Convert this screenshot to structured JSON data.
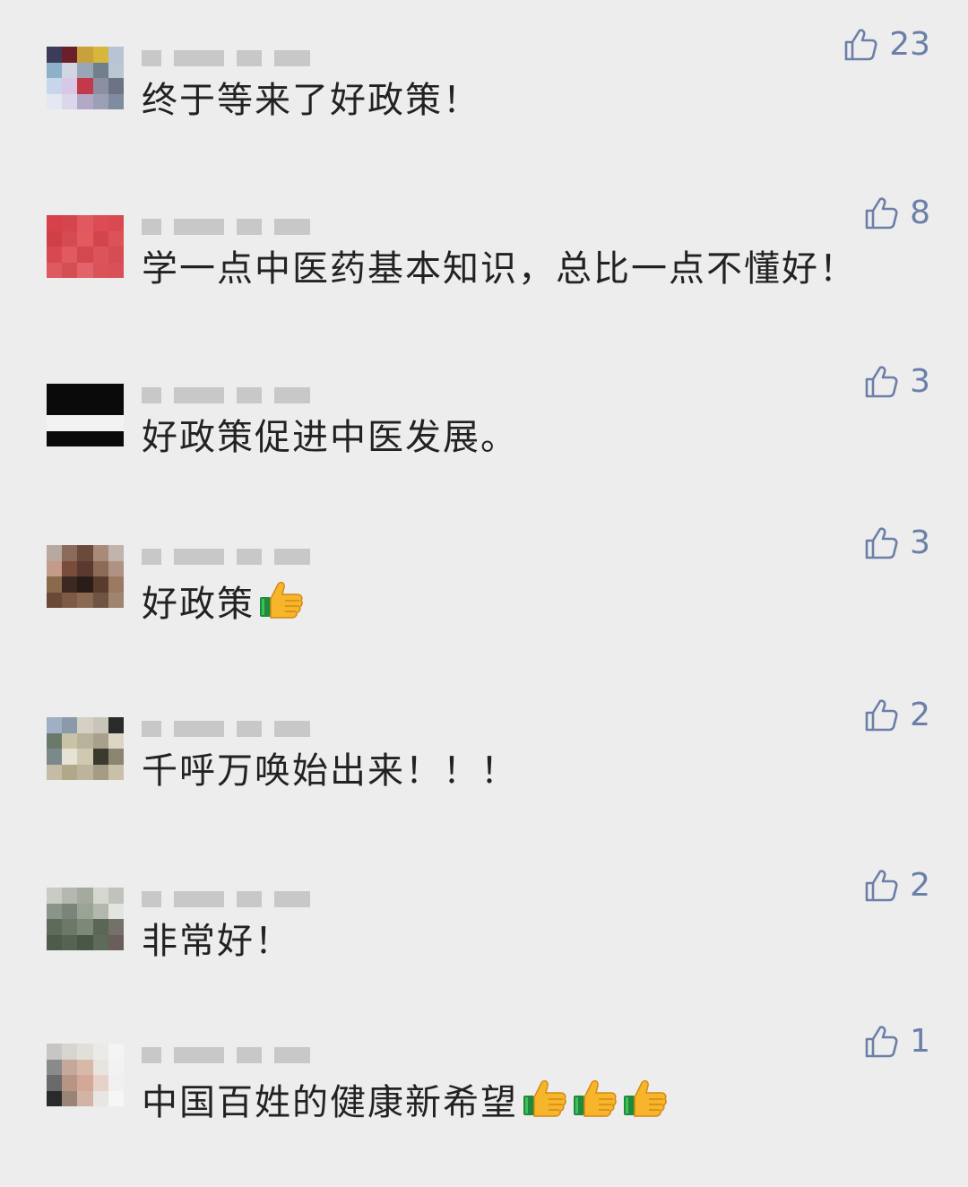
{
  "comments": [
    {
      "text": "终于等来了好政策！",
      "likes": "23",
      "emoji_count": 0,
      "avatar_colors": [
        "#3c3c5a",
        "#6b1f2a",
        "#c9a13a",
        "#d6b73c",
        "#b8c3d6",
        "#8fb0c9",
        "#d2d6e2",
        "#9aa6b8",
        "#6f7f8c",
        "#b9c6d4",
        "#c8d6ec",
        "#d8c8e6",
        "#c23a4a",
        "#8c8fa2",
        "#6c7484",
        "#e4e8f2",
        "#dcd6ea",
        "#b4a8c8",
        "#9ba0b6",
        "#7f8ba1"
      ]
    },
    {
      "text": "学一点中医药基本知识，总比一点不懂好！",
      "likes": "8",
      "emoji_count": 0,
      "avatar_colors": [
        "#d9414a",
        "#d4464c",
        "#e25860",
        "#dc4c52",
        "#d84a50",
        "#cf3f46",
        "#d64a52",
        "#e15a5e",
        "#d3454c",
        "#dd5258",
        "#d84850",
        "#e05a60",
        "#d2484e",
        "#dc545a",
        "#d64c52",
        "#df5a60",
        "#d44e54",
        "#e2646a",
        "#db5258",
        "#d85058"
      ]
    },
    {
      "text": "好政策促进中医发展。",
      "likes": "3",
      "emoji_count": 0,
      "avatar_colors": [
        "#0a0a0a",
        "#0a0a0a",
        "#0a0a0a",
        "#0a0a0a",
        "#0a0a0a",
        "#0a0a0a",
        "#0a0a0a",
        "#0a0a0a",
        "#0a0a0a",
        "#0a0a0a",
        "#f2f2f2",
        "#f2f2f2",
        "#f2f2f2",
        "#f2f2f2",
        "#f2f2f2",
        "#0a0a0a",
        "#0a0a0a",
        "#0a0a0a",
        "#0a0a0a",
        "#0a0a0a"
      ]
    },
    {
      "text": "好政策",
      "likes": "3",
      "emoji_count": 1,
      "avatar_colors": [
        "#b7a8a0",
        "#8a6a58",
        "#6b4a3c",
        "#a88a78",
        "#c2b4ac",
        "#c49a88",
        "#7a4a3a",
        "#5a3a2e",
        "#8c6a58",
        "#b09282",
        "#8a6a4c",
        "#3c2a22",
        "#2a1c16",
        "#5a3c2c",
        "#9c7a62",
        "#6a4a36",
        "#7c5a44",
        "#8a6a52",
        "#6e5442",
        "#a08470"
      ]
    },
    {
      "text": "千呼万唤始出来！！！",
      "likes": "2",
      "emoji_count": 0,
      "avatar_colors": [
        "#9fb0c4",
        "#8a9aa8",
        "#d4d0c4",
        "#c8c4b8",
        "#2a2a2a",
        "#6a7a6a",
        "#c9c2a6",
        "#b8b29a",
        "#a8a08a",
        "#dcd6c6",
        "#7a8a8a",
        "#e6e2d4",
        "#d0c8b0",
        "#3a3a2e",
        "#8a8470",
        "#c4bca4",
        "#b0a888",
        "#bcb49c",
        "#a49c84",
        "#c8c0a8"
      ]
    },
    {
      "text": "非常好！",
      "likes": "2",
      "emoji_count": 0,
      "avatar_colors": [
        "#c8ccc4",
        "#b4b8b0",
        "#a4aa9e",
        "#d4d6d0",
        "#c0c2bc",
        "#8a9488",
        "#7a8478",
        "#9aa494",
        "#b2b8ae",
        "#e2e4e0",
        "#5e6a5a",
        "#6e7868",
        "#7e8878",
        "#5a6656",
        "#74706a",
        "#4e5a4a",
        "#566252",
        "#4a5646",
        "#5e6a5a",
        "#6a5e5a"
      ]
    },
    {
      "text": "中国百姓的健康新希望",
      "likes": "1",
      "emoji_count": 3,
      "avatar_colors": [
        "#c8c6c4",
        "#d8d4d0",
        "#e2ded8",
        "#eceae6",
        "#f4f4f4",
        "#8a8a8a",
        "#c4a89c",
        "#d8b8a8",
        "#e8e4e0",
        "#f2f2f2",
        "#6a6a6a",
        "#b89484",
        "#d4a898",
        "#e6d2c8",
        "#f0f0f0",
        "#2a2a2a",
        "#9a8478",
        "#d2b4a6",
        "#e8e6e4",
        "#f6f6f6"
      ]
    }
  ],
  "colors": {
    "background": "#ededed",
    "text": "#222222",
    "like_accent": "#6b7fa8",
    "nickname_blur": "#c8c8c8"
  },
  "icons": {
    "like": "thumbs-up-outline-icon",
    "emoji": "thumbs-up-emoji-icon"
  }
}
